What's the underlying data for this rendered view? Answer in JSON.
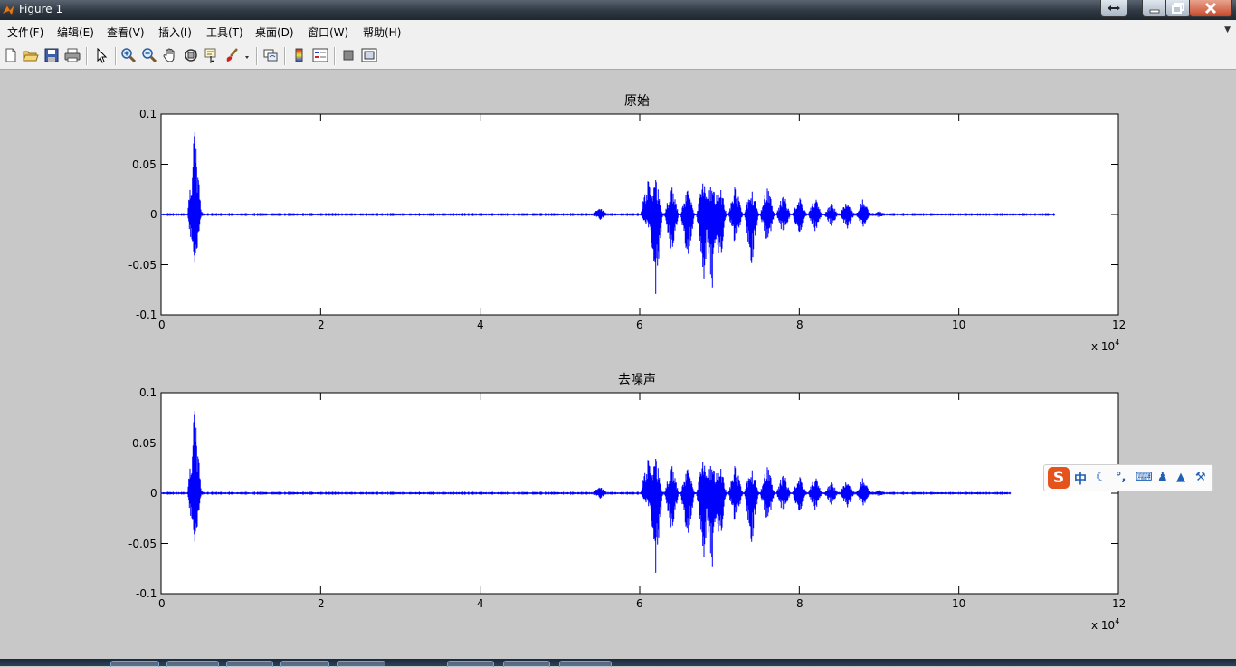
{
  "window": {
    "title": "Figure 1"
  },
  "menu": [
    "文件(F)",
    "编辑(E)",
    "查看(V)",
    "插入(I)",
    "工具(T)",
    "桌面(D)",
    "窗口(W)",
    "帮助(H)"
  ],
  "toolbar": {
    "icons": [
      "new-figure-icon",
      "open-file-icon",
      "save-icon",
      "print-icon",
      "pointer-icon",
      "zoom-in-icon",
      "zoom-out-icon",
      "pan-hand-icon",
      "rotate-3d-icon",
      "data-cursor-icon",
      "brush-icon",
      "link-plot-icon",
      "colorbar-icon",
      "legend-icon",
      "hide-plot-tools-icon",
      "show-plot-tools-icon"
    ]
  },
  "ime": {
    "mode": "中"
  },
  "chart_data": [
    {
      "type": "line",
      "title": "原始",
      "x_ticks": [
        "0",
        "2",
        "4",
        "6",
        "8",
        "10",
        "12"
      ],
      "y_ticks": [
        "0.1",
        "0.05",
        "0",
        "-0.05",
        "-0.1"
      ],
      "x_exponent": "x 10",
      "x_exponent_power": "4",
      "xlim": [
        0,
        120000
      ],
      "ylim": [
        -0.1,
        0.1
      ],
      "series_color": "#0000ff",
      "signal_end": 112000,
      "events": [
        {
          "x": 4200,
          "max": 0.087,
          "min": -0.054
        },
        {
          "x": 4500,
          "max": 0.012,
          "min": -0.008
        },
        {
          "x": 55000,
          "max": 0.008,
          "min": -0.006
        },
        {
          "x": 61000,
          "max": 0.04,
          "min": -0.015
        },
        {
          "x": 62000,
          "max": 0.038,
          "min": -0.087
        },
        {
          "x": 64000,
          "max": 0.031,
          "min": -0.045
        },
        {
          "x": 66000,
          "max": 0.027,
          "min": -0.046
        },
        {
          "x": 68000,
          "max": 0.044,
          "min": -0.069
        },
        {
          "x": 69000,
          "max": 0.037,
          "min": -0.087
        },
        {
          "x": 70000,
          "max": 0.035,
          "min": -0.055
        },
        {
          "x": 72000,
          "max": 0.03,
          "min": -0.035
        },
        {
          "x": 74000,
          "max": 0.03,
          "min": -0.057
        },
        {
          "x": 76000,
          "max": 0.032,
          "min": -0.033
        },
        {
          "x": 78000,
          "max": 0.022,
          "min": -0.021
        },
        {
          "x": 80000,
          "max": 0.022,
          "min": -0.021
        },
        {
          "x": 82000,
          "max": 0.02,
          "min": -0.018
        },
        {
          "x": 84000,
          "max": 0.012,
          "min": -0.012
        },
        {
          "x": 86000,
          "max": 0.017,
          "min": -0.015
        },
        {
          "x": 88000,
          "max": 0.016,
          "min": -0.014
        },
        {
          "x": 90000,
          "max": 0.004,
          "min": -0.003
        }
      ]
    },
    {
      "type": "line",
      "title": "去噪声",
      "x_ticks": [
        "0",
        "2",
        "4",
        "6",
        "8",
        "10",
        "12"
      ],
      "y_ticks": [
        "0.1",
        "0.05",
        "0",
        "-0.05",
        "-0.1"
      ],
      "x_exponent": "x 10",
      "x_exponent_power": "4",
      "xlim": [
        0,
        120000
      ],
      "ylim": [
        -0.1,
        0.1
      ],
      "series_color": "#0000ff",
      "signal_end": 106500,
      "events": [
        {
          "x": 4200,
          "max": 0.087,
          "min": -0.054
        },
        {
          "x": 4500,
          "max": 0.012,
          "min": -0.008
        },
        {
          "x": 55000,
          "max": 0.008,
          "min": -0.006
        },
        {
          "x": 61000,
          "max": 0.04,
          "min": -0.015
        },
        {
          "x": 62000,
          "max": 0.038,
          "min": -0.087
        },
        {
          "x": 64000,
          "max": 0.031,
          "min": -0.045
        },
        {
          "x": 66000,
          "max": 0.027,
          "min": -0.046
        },
        {
          "x": 68000,
          "max": 0.044,
          "min": -0.069
        },
        {
          "x": 69000,
          "max": 0.037,
          "min": -0.087
        },
        {
          "x": 70000,
          "max": 0.035,
          "min": -0.055
        },
        {
          "x": 72000,
          "max": 0.03,
          "min": -0.035
        },
        {
          "x": 74000,
          "max": 0.03,
          "min": -0.057
        },
        {
          "x": 76000,
          "max": 0.032,
          "min": -0.033
        },
        {
          "x": 78000,
          "max": 0.022,
          "min": -0.021
        },
        {
          "x": 80000,
          "max": 0.022,
          "min": -0.021
        },
        {
          "x": 82000,
          "max": 0.02,
          "min": -0.018
        },
        {
          "x": 84000,
          "max": 0.012,
          "min": -0.012
        },
        {
          "x": 86000,
          "max": 0.017,
          "min": -0.015
        },
        {
          "x": 88000,
          "max": 0.016,
          "min": -0.014
        },
        {
          "x": 90000,
          "max": 0.004,
          "min": -0.003
        }
      ]
    }
  ]
}
